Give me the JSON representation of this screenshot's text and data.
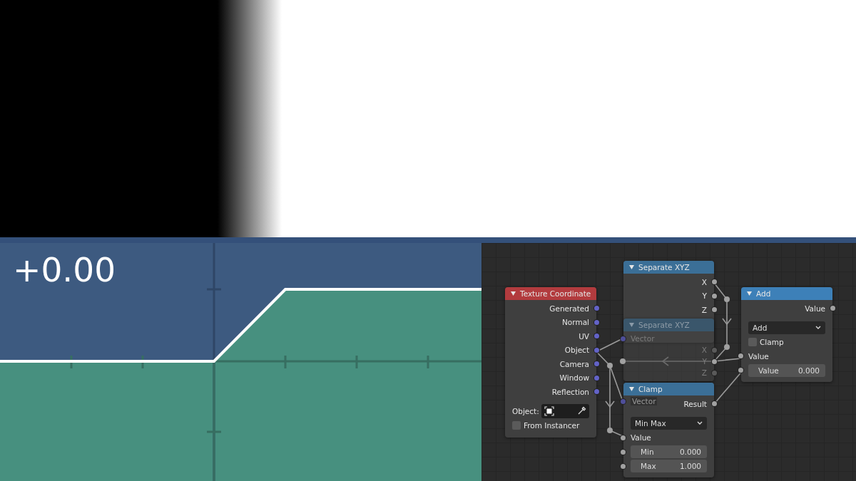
{
  "graph": {
    "readout": "+0.00"
  },
  "node_editor": {
    "nodes": [
      {
        "title": "Separate XYZ",
        "color": "#3b6f97",
        "dimmed": false,
        "rows": [
          {
            "kind": "output",
            "label": "X",
            "color": "#a1a1a1"
          },
          {
            "kind": "output",
            "label": "Y",
            "color": "#a1a1a1"
          },
          {
            "kind": "output",
            "label": "Z",
            "color": "#a1a1a1"
          }
        ]
      },
      {
        "title": "Separate XYZ",
        "color": "#3a566b",
        "dimmed": true,
        "rows": [
          {
            "kind": "input",
            "label": "Vector",
            "color": "#4f4f9a"
          },
          {
            "kind": "output",
            "label": "X",
            "color": "#5a5a5a"
          },
          {
            "kind": "output",
            "label": "Y",
            "color": "#a1a1a1"
          },
          {
            "kind": "output",
            "label": "Z",
            "color": "#5a5a5a"
          }
        ]
      },
      {
        "title": "Texture Coordinate",
        "color": "#b23b3e",
        "dimmed": false,
        "rows": [
          {
            "kind": "output",
            "label": "Generated",
            "color": "#6363c7"
          },
          {
            "kind": "output",
            "label": "Normal",
            "color": "#6363c7"
          },
          {
            "kind": "output",
            "label": "UV",
            "color": "#6363c7"
          },
          {
            "kind": "output",
            "label": "Object",
            "color": "#6363c7"
          },
          {
            "kind": "output",
            "label": "Camera",
            "color": "#6363c7"
          },
          {
            "kind": "output",
            "label": "Window",
            "color": "#6363c7"
          },
          {
            "kind": "output",
            "label": "Reflection",
            "color": "#6363c7"
          },
          {
            "kind": "object",
            "label": "Object:"
          },
          {
            "kind": "checkbox",
            "label": "From Instancer",
            "checked": false
          }
        ]
      },
      {
        "title": "Clamp",
        "color": "#3b6f97",
        "dimmed": false,
        "rows": [
          {
            "kind": "output",
            "label": "Result",
            "color": "#a1a1a1"
          },
          {
            "kind": "dropdown",
            "value": "Min Max"
          },
          {
            "kind": "input",
            "label": "Value",
            "color": "#a1a1a1"
          },
          {
            "kind": "number",
            "label": "Min",
            "value": "0.000",
            "color": "#a1a1a1"
          },
          {
            "kind": "number",
            "label": "Max",
            "value": "1.000",
            "color": "#a1a1a1"
          }
        ]
      },
      {
        "dimmed": true,
        "rows": [
          {
            "kind": "input",
            "label": "Vector",
            "color": "#4f4f9a"
          }
        ]
      },
      {
        "title": "Add",
        "color": "#3d80b8",
        "dimmed": false,
        "rows": [
          {
            "kind": "output",
            "label": "Value",
            "color": "#a1a1a1"
          },
          {
            "kind": "dropdown",
            "value": "Add"
          },
          {
            "kind": "checkbox",
            "label": "Clamp",
            "checked": false
          },
          {
            "kind": "input",
            "label": "Value",
            "color": "#a1a1a1"
          },
          {
            "kind": "number",
            "label": "Value",
            "value": "0.000",
            "color": "#a1a1a1"
          }
        ]
      }
    ]
  }
}
